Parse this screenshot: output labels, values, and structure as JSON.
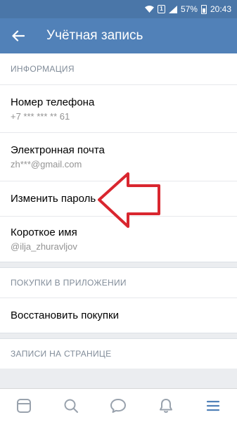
{
  "status_bar": {
    "sim_label": "1",
    "battery": "57%",
    "time": "20:43"
  },
  "header": {
    "title": "Учётная запись"
  },
  "sections": [
    {
      "header": "ИНФОРМАЦИЯ",
      "items": [
        {
          "title": "Номер телефона",
          "subtitle": "+7 *** *** ** 61"
        },
        {
          "title": "Электронная почта",
          "subtitle": "zh***@gmail.com"
        },
        {
          "title": "Изменить пароль"
        },
        {
          "title": "Короткое имя",
          "subtitle": "@ilja_zhuravljov"
        }
      ]
    },
    {
      "header": "ПОКУПКИ В ПРИЛОЖЕНИИ",
      "items": [
        {
          "title": "Восстановить покупки"
        }
      ]
    },
    {
      "header": "ЗАПИСИ НА СТРАНИЦЕ",
      "items": []
    }
  ],
  "bottom_nav": [
    {
      "icon": "news-icon",
      "active": false
    },
    {
      "icon": "search-icon",
      "active": false
    },
    {
      "icon": "messages-icon",
      "active": false
    },
    {
      "icon": "notifications-icon",
      "active": false
    },
    {
      "icon": "menu-icon",
      "active": true
    }
  ],
  "colors": {
    "status_bar": "#4a76a8",
    "app_bar": "#5181b8",
    "accent": "#5181b8",
    "annotation_arrow": "#d9262f"
  }
}
